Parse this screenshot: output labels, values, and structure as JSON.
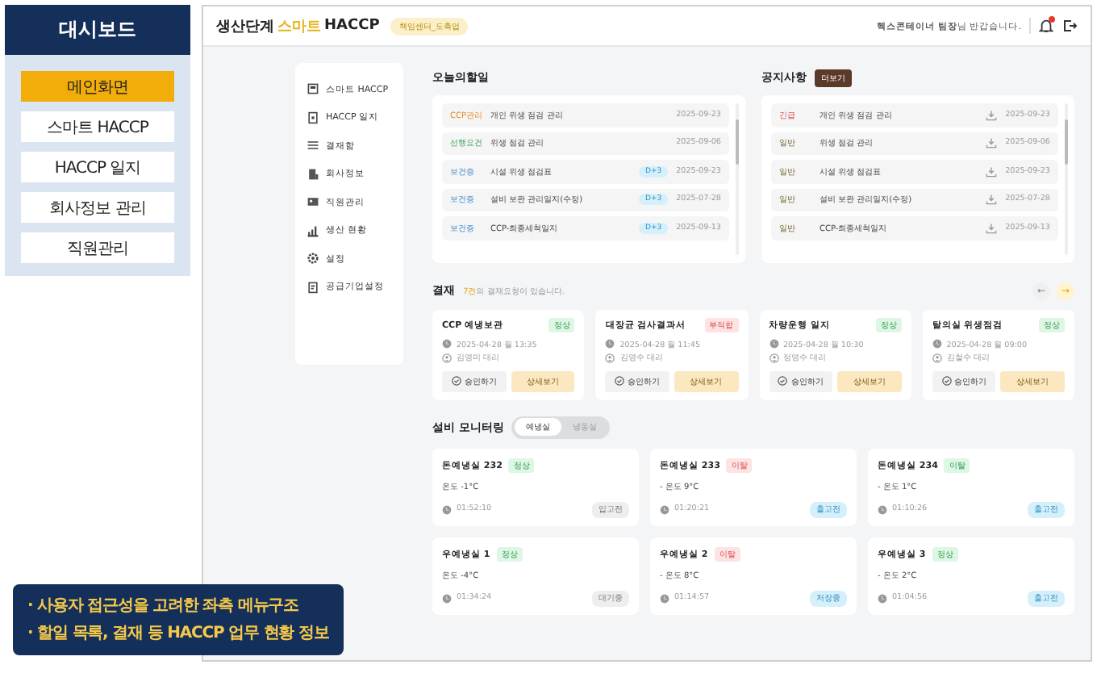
{
  "sidebar": {
    "title": "대시보드",
    "items": [
      {
        "label": "메인화면",
        "selected": true
      },
      {
        "label": "스마트 HACCP",
        "selected": false
      },
      {
        "label": "HACCP 일지",
        "selected": false
      },
      {
        "label": "회사정보 관리",
        "selected": false
      },
      {
        "label": "직원관리",
        "selected": false
      }
    ]
  },
  "header": {
    "title_prefix": "생산단계",
    "title_highlight": "스마트",
    "title_suffix": "HACCP",
    "badge": "책임센터_도축업",
    "greeting": "**헥스콘테이너 팀장**님 반갑습니다.",
    "has_notification": true
  },
  "nav": {
    "items": [
      {
        "label": "스마트 HACCP"
      },
      {
        "label": "HACCP 일지"
      },
      {
        "label": "결재함"
      },
      {
        "label": "회사정보"
      },
      {
        "label": "직원관리"
      },
      {
        "label": "생산 현황"
      },
      {
        "label": "설정"
      },
      {
        "label": "공급기업설정"
      }
    ]
  },
  "todo": {
    "title": "오늘의할일",
    "items": [
      {
        "category": "CCP관리",
        "kind": "ccp",
        "task": "개인 위생 점검 관리",
        "date": "2025-09-23"
      },
      {
        "category": "선행요건",
        "kind": "prereq",
        "task": "위생 점검 관리",
        "date": "2025-09-06"
      },
      {
        "category": "보건증",
        "kind": "health",
        "task": "시설 위생 점검표",
        "badge": "D+3",
        "date": "2025-09-23"
      },
      {
        "category": "보건증",
        "kind": "health",
        "task": "설비 보완 관리일지(수정)",
        "badge": "D+3",
        "date": "2025-07-28"
      },
      {
        "category": "보건증",
        "kind": "health",
        "task": "CCP-최종세척일지",
        "badge": "D+3",
        "date": "2025-09-13"
      }
    ]
  },
  "notices": {
    "title": "공지사항",
    "more_button": "더보기",
    "items": [
      {
        "category": "긴급",
        "urgent": true,
        "title": "개인 위생 점검 관리",
        "date": "2025-09-23"
      },
      {
        "category": "일반",
        "urgent": false,
        "title": "위생 점검 관리",
        "date": "2025-09-06"
      },
      {
        "category": "일반",
        "urgent": false,
        "title": "시설 위생 점검표",
        "date": "2025-09-23"
      },
      {
        "category": "일반",
        "urgent": false,
        "title": "설비 보완 관리일지(수정)",
        "date": "2025-07-28"
      },
      {
        "category": "일반",
        "urgent": false,
        "title": "CCP-최종세척일지",
        "date": "2025-09-13"
      }
    ]
  },
  "approval": {
    "title": "결재",
    "count": "7건",
    "message": "의 결재요청이 있습니다.",
    "arrows": [
      {
        "label": "←",
        "active": false
      },
      {
        "label": "→",
        "active": true
      }
    ],
    "cards": [
      {
        "title": "CCP 예냉보관",
        "status": {
          "label": "정상",
          "kind": "ok"
        },
        "datetime": "2025-04-28 월 13:35",
        "person": "김영미 대리",
        "approve": "승인하기",
        "detail": "상세보기"
      },
      {
        "title": "대장균 검사결과서",
        "status": {
          "label": "부적합",
          "kind": "bad"
        },
        "datetime": "2025-04-28 월 11:45",
        "person": "김영수 대리",
        "approve": "승인하기",
        "detail": "상세보기"
      },
      {
        "title": "차량운행 일지",
        "status": {
          "label": "정상",
          "kind": "ok"
        },
        "datetime": "2025-04-28 월 10:30",
        "person": "정영수 대리",
        "approve": "승인하기",
        "detail": "상세보기"
      },
      {
        "title": "탈의실 위생점검",
        "status": {
          "label": "정상",
          "kind": "ok"
        },
        "datetime": "2025-04-28 월 09:00",
        "person": "김철수 대리",
        "approve": "승인하기",
        "detail": "상세보기"
      }
    ]
  },
  "monitoring": {
    "title": "설비 모니터링",
    "tabs": [
      {
        "label": "예냉실",
        "selected": true
      },
      {
        "label": "냉동실",
        "selected": false
      }
    ],
    "rooms": [
      {
        "name": "돈예냉실 232",
        "status": {
          "label": "정상",
          "kind": "ok"
        },
        "temperature": "온도 -1°C",
        "time": "01:52:10",
        "state": {
          "label": "입고전",
          "kind": "grey"
        }
      },
      {
        "name": "돈예냉실 233",
        "status": {
          "label": "이탈",
          "kind": "bad"
        },
        "temperature": "- 온도 9°C",
        "time": "01:20:21",
        "state": {
          "label": "출고전",
          "kind": "blue"
        }
      },
      {
        "name": "돈예냉실 234",
        "status": {
          "label": "이탈",
          "kind": "ok"
        },
        "temperature": "- 온도 1°C",
        "time": "01:10:26",
        "state": {
          "label": "출고전",
          "kind": "blue"
        }
      },
      {
        "name": "우예냉실 1",
        "status": {
          "label": "정상",
          "kind": "ok"
        },
        "temperature": "온도 -4°C",
        "time": "01:34:24",
        "state": {
          "label": "대기중",
          "kind": "grey"
        }
      },
      {
        "name": "우예냉실 2",
        "status": {
          "label": "이탈",
          "kind": "bad"
        },
        "temperature": "- 온도 8°C",
        "time": "01:14:57",
        "state": {
          "label": "저장중",
          "kind": "blue"
        }
      },
      {
        "name": "우예냉실 3",
        "status": {
          "label": "정상",
          "kind": "ok"
        },
        "temperature": "- 온도 2°C",
        "time": "01:04:56",
        "state": {
          "label": "출고전",
          "kind": "blue"
        }
      }
    ]
  },
  "callout": {
    "lines": [
      "· 사용자 접근성을 고려한 좌측 메뉴구조",
      "· 할일 목록, 결재 등 HACCP 업무 현황 정보"
    ]
  }
}
